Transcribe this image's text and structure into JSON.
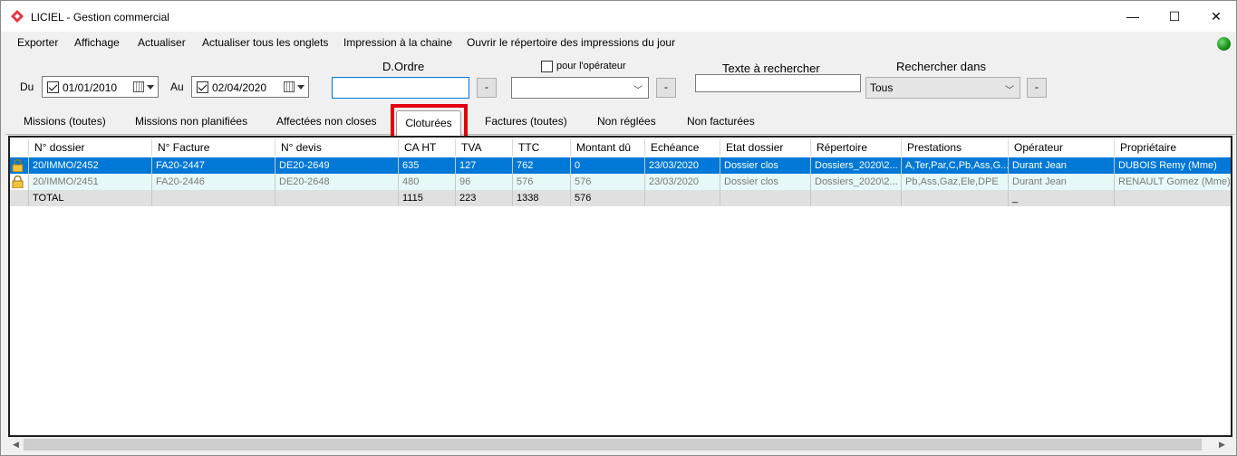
{
  "window": {
    "title": "LICIEL - Gestion commercial",
    "minimize": "—",
    "maximize": "☐",
    "close": "✕"
  },
  "menu": [
    "Exporter",
    "Affichage",
    "Actualiser",
    "Actualiser tous les onglets",
    "Impression à la chaine",
    "Ouvrir le répertoire des impressions du jour"
  ],
  "filters": {
    "du_label": "Du",
    "du_value": "01/01/2010",
    "au_label": "Au",
    "au_value": "02/04/2020",
    "dordre_label": "D.Ordre",
    "dordre_value": "",
    "minus_label": "-",
    "pour_operateur_label": "pour l'opérateur",
    "operateur_value": "",
    "texte_label": "Texte à rechercher",
    "texte_value": "",
    "rechercher_label": "Rechercher dans",
    "rechercher_value": "Tous"
  },
  "tabs": [
    "Missions (toutes)",
    "Missions non planifiées",
    "Affectées non closes",
    "Cloturées",
    "Factures (toutes)",
    "Non réglées",
    "Non facturées"
  ],
  "active_tab": "Cloturées",
  "table": {
    "columns": [
      "N° dossier",
      "N° Facture",
      "N° devis",
      "CA HT",
      "TVA",
      "TTC",
      "Montant dû",
      "Echéance",
      "Etat dossier",
      "Répertoire",
      "Prestations",
      "Opérateur",
      "Propriétaire"
    ],
    "rows": [
      [
        "20/IMMO/2452",
        "FA20-2447",
        "DE20-2649",
        "635",
        "127",
        "762",
        "0",
        "23/03/2020",
        "Dossier clos",
        "Dossiers_2020\\2...",
        "A,Ter,Par,C,Pb,Ass,G...",
        "Durant Jean",
        "DUBOIS Remy (Mme)"
      ],
      [
        "20/IMMO/2451",
        "FA20-2446",
        "DE20-2648",
        "480",
        "96",
        "576",
        "576",
        "23/03/2020",
        "Dossier clos",
        "Dossiers_2020\\2...",
        "Pb,Ass,Gaz,Ele,DPE",
        "Durant Jean",
        "RENAULT Gomez (Mme)"
      ]
    ],
    "total": [
      "TOTAL",
      "",
      "",
      "1115",
      "223",
      "1338",
      "576",
      "",
      "",
      "",
      "",
      "_",
      ""
    ]
  },
  "colors": {
    "selection": "#0078d7",
    "highlight": "#e3000f",
    "alt_row": "#e6f8f8"
  },
  "icons": [
    "app-logo-icon",
    "calendar-icon",
    "lock-icon",
    "status-ok-icon"
  ]
}
